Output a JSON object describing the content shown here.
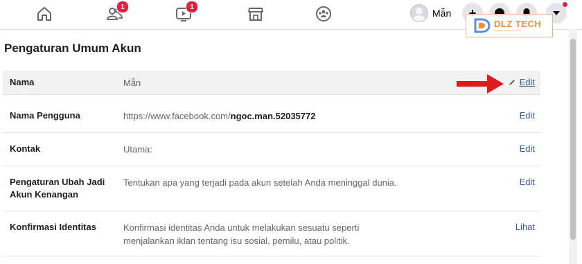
{
  "topbar": {
    "nav": [
      {
        "name": "home",
        "badge": ""
      },
      {
        "name": "friends",
        "badge": "1"
      },
      {
        "name": "watch",
        "badge": "1"
      },
      {
        "name": "marketplace",
        "badge": ""
      },
      {
        "name": "groups",
        "badge": ""
      }
    ],
    "profile_name": "Mẫn",
    "buttons": [
      {
        "name": "create",
        "glyph": "+"
      },
      {
        "name": "messenger",
        "glyph": ""
      },
      {
        "name": "notifications",
        "glyph": ""
      },
      {
        "name": "account-menu",
        "glyph": ""
      }
    ]
  },
  "watermark": {
    "title": "DLZ TECH",
    "subtitle": "Cùng bạn kiến tạo sự số hóa"
  },
  "page": {
    "title": "Pengaturan Umum Akun"
  },
  "rows": [
    {
      "label": "Nama",
      "value": "Mẫn",
      "action": "Edit"
    },
    {
      "label": "Nama Pengguna",
      "value_prefix": "https://www.facebook.com/",
      "value_bold": "ngoc.man.52035772",
      "action": "Edit"
    },
    {
      "label": "Kontak",
      "value": "Utama:",
      "action": "Edit"
    },
    {
      "label_line1": "Pengaturan Ubah Jadi",
      "label_line2": "Akun Kenangan",
      "value": "Tentukan apa yang terjadi pada akun setelah Anda meninggal dunia.",
      "action": "Edit"
    },
    {
      "label": "Konfirmasi Identitas",
      "value_line1": "Konfirmasi identitas Anda untuk melakukan sesuatu seperti",
      "value_line2": "menjalankan iklan tentang isu sosial, pemilu, atau politik.",
      "action": "Lihat"
    }
  ],
  "colors": {
    "link": "#385898",
    "badge": "#e41e3f",
    "arrow": "#e0191e",
    "highlight_row": "#f2f2f2",
    "watermark": "#f28c33"
  }
}
